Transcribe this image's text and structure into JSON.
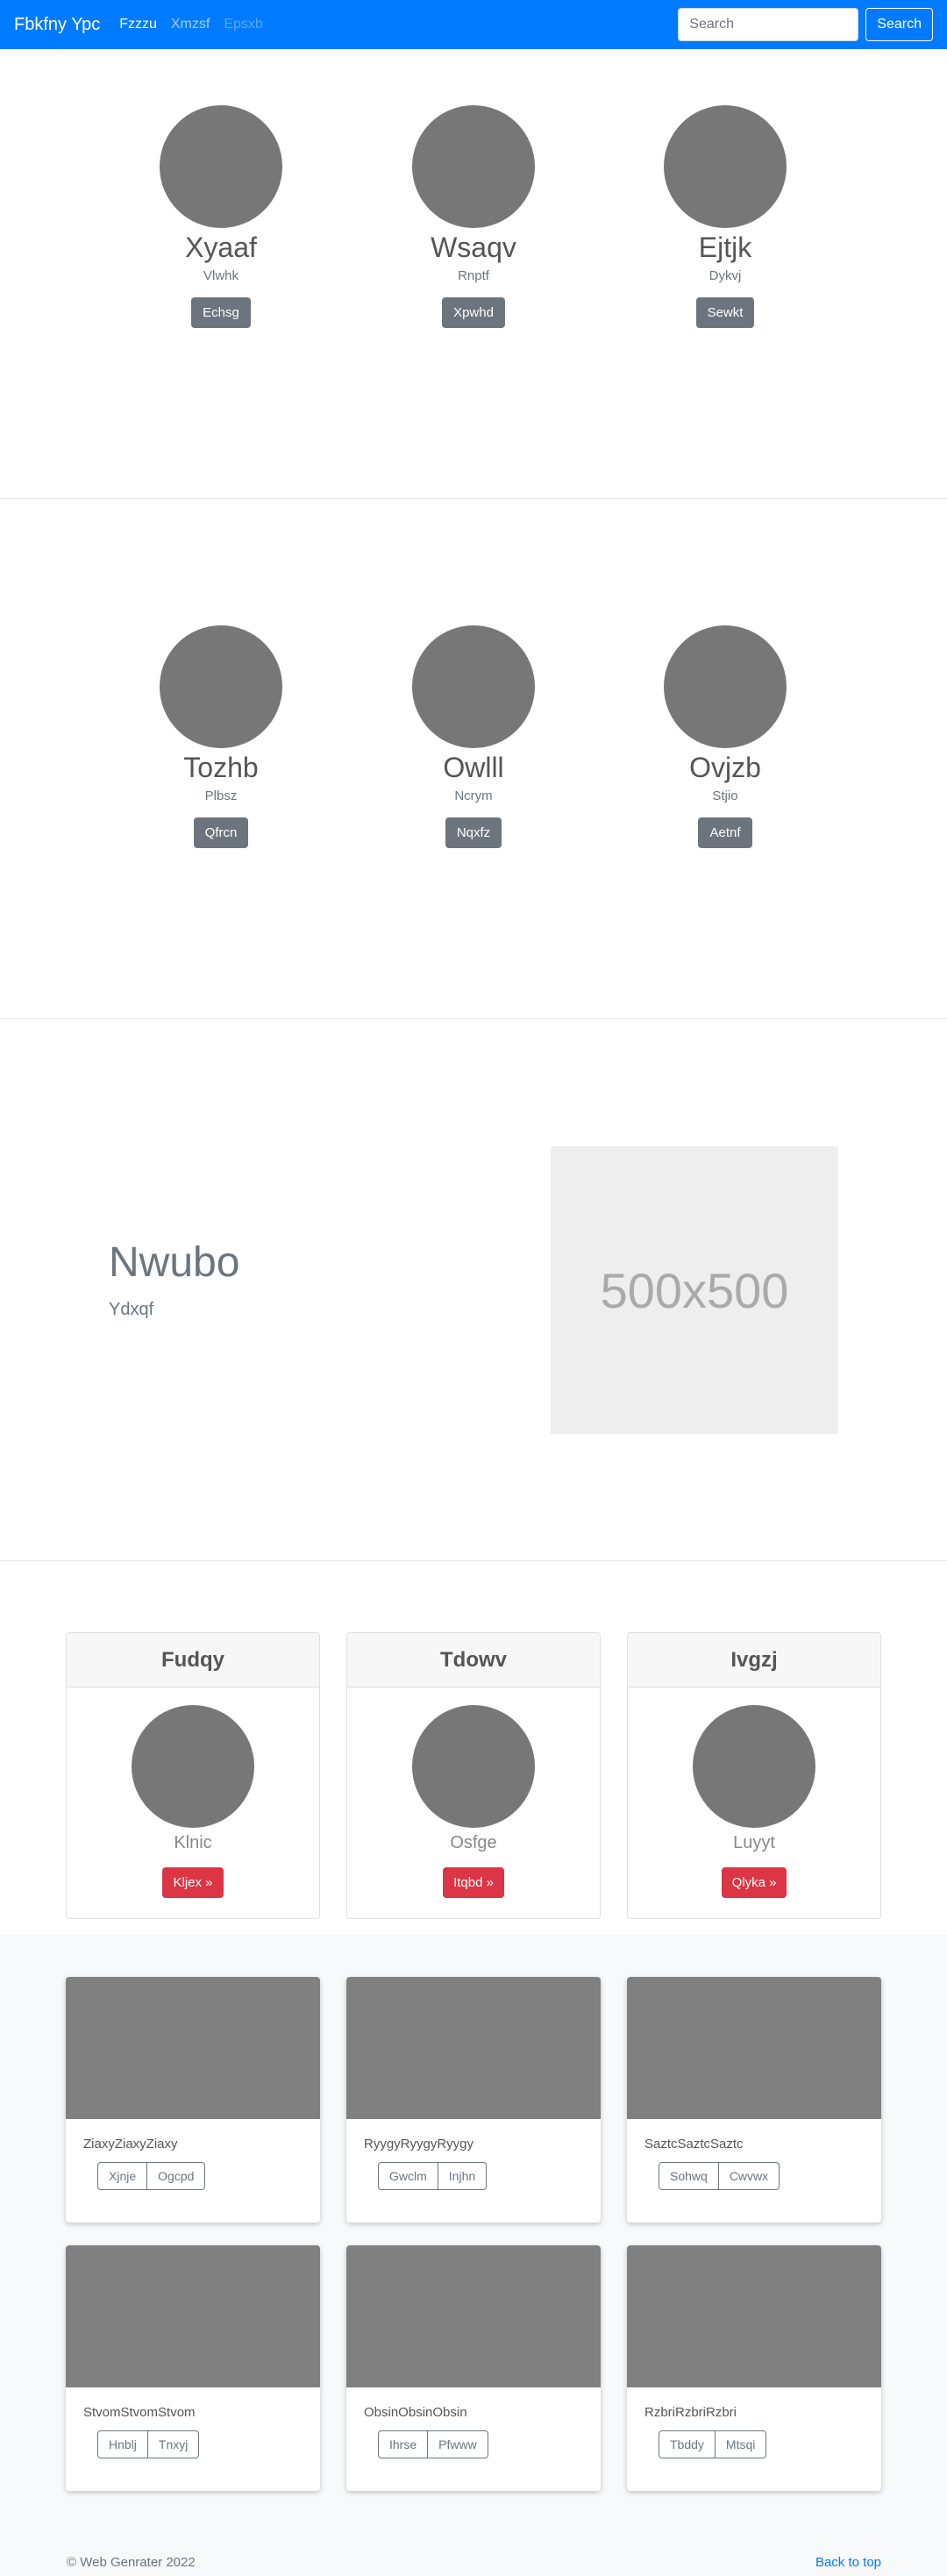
{
  "navbar": {
    "brand": "Fbkfny Ypc",
    "links": [
      {
        "label": "Fzzzu",
        "state": "active"
      },
      {
        "label": "Xmzsf",
        "state": "normal"
      },
      {
        "label": "Epsxb",
        "state": "disabled"
      }
    ],
    "search_placeholder": "Search",
    "search_button": "Search"
  },
  "team_rows": [
    [
      {
        "name": "Xyaaf",
        "role": "Vlwhk",
        "button": "Echsg"
      },
      {
        "name": "Wsaqv",
        "role": "Rnptf",
        "button": "Xpwhd"
      },
      {
        "name": "Ejtjk",
        "role": "Dykvj",
        "button": "Sewkt"
      }
    ],
    [
      {
        "name": "Tozhb",
        "role": "Plbsz",
        "button": "Qfrcn"
      },
      {
        "name": "Owlll",
        "role": "Ncrym",
        "button": "Nqxfz"
      },
      {
        "name": "Ovjzb",
        "role": "Stjio",
        "button": "Aetnf"
      }
    ]
  ],
  "feature": {
    "heading": "Nwubo",
    "subheading": "Ydxqf",
    "image_label": "500x500"
  },
  "pricing": [
    {
      "title": "Fudqy",
      "text": "Klnic",
      "button": "Kljex »"
    },
    {
      "title": "Tdowv",
      "text": "Osfge",
      "button": "Itqbd »"
    },
    {
      "title": "Ivgzj",
      "text": "Luyyt",
      "button": "Qlyka »"
    }
  ],
  "album": [
    {
      "text": "ZiaxyZiaxyZiaxy",
      "buttons": [
        "Xjnje",
        "Ogcpd"
      ]
    },
    {
      "text": "RyygyRyygyRyygy",
      "buttons": [
        "Gwclm",
        "Injhn"
      ]
    },
    {
      "text": "SaztcSaztcSaztc",
      "buttons": [
        "Sohwq",
        "Cwvwx"
      ]
    },
    {
      "text": "StvomStvomStvom",
      "buttons": [
        "Hnblj",
        "Tnxyj"
      ]
    },
    {
      "text": "ObsinObsinObsin",
      "buttons": [
        "Ihrse",
        "Pfwww"
      ]
    },
    {
      "text": "RzbriRzbriRzbri",
      "buttons": [
        "Tbddy",
        "Mtsqi"
      ]
    }
  ],
  "footer": {
    "copyright": "© Web Genrater 2022",
    "back_to_top": "Back to top"
  }
}
